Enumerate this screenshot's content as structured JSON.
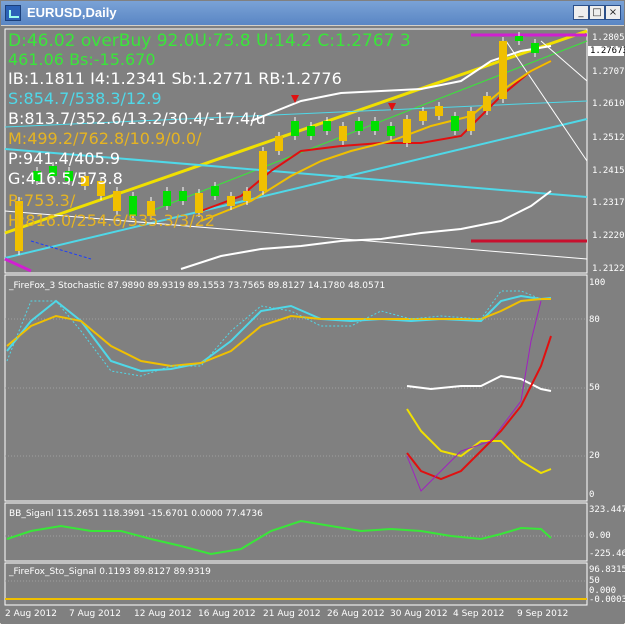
{
  "window": {
    "title": "EURUSD,Daily",
    "minimize": "_",
    "maximize": "□",
    "close": "×"
  },
  "info_lines": [
    {
      "text": "D:46.02 overBuy  92.0U:73.8 U:14.2 C:1.2767 3",
      "color": "#39e639"
    },
    {
      "text": "461.06 Bs:-15.670",
      "color": "#39e639"
    },
    {
      "text": "IB:1.1811 I4:1.2341 Sb:1.2771 RB:1.2776",
      "color": "#ffffff"
    },
    {
      "text": "S:854.7/538.3/12.9",
      "color": "#4fd8e8"
    },
    {
      "text": "B:813.7/352.6/13.2/30.4/-17.4/u",
      "color": "#ffffff"
    },
    {
      "text": "M:499.2/762.8/10.9/0.0/",
      "color": "#e6b422"
    },
    {
      "text": "P:941.4/405.9",
      "color": "#ffffff"
    },
    {
      "text": "G:416.5/573.8",
      "color": "#ffffff"
    },
    {
      "text": "R:753.3/",
      "color": "#e6b422"
    },
    {
      "text": "H:816.0/254.6/535.3/3/22",
      "color": "#e6b422"
    }
  ],
  "price_scale": [
    "1.28050",
    "1.27075",
    "1.26100",
    "1.25125",
    "1.24150",
    "1.23175",
    "1.22200",
    "1.21225"
  ],
  "current_price": "1.27673",
  "stoch_panel": {
    "title": "_FireFox_3 Stochastic 87.9890 89.9319 89.1553 73.7565 89.8127 14.1780 48.0571",
    "scale": [
      "100",
      "80",
      "50",
      "20",
      "0"
    ]
  },
  "bb_panel": {
    "title": "BB_Siganl 115.2651 118.3991 -15.6701 0.0000 77.4736",
    "scale": [
      "323.447",
      "0.00",
      "-225.460"
    ]
  },
  "sto_signal_panel": {
    "title": "_FireFox_Sto_Signal 0.1193 89.8127 89.9319",
    "scale": [
      "96.8315",
      "50",
      "0.000",
      "-0.000357"
    ]
  },
  "dates": [
    "2 Aug 2012",
    "7 Aug 2012",
    "12 Aug 2012",
    "16 Aug 2012",
    "21 Aug 2012",
    "26 Aug 2012",
    "30 Aug 2012",
    "4 Sep 2012",
    "9 Sep 2012"
  ],
  "colors": {
    "background": "#808080",
    "bull": "#00e000",
    "bear": "#f0c000",
    "cyan": "#4fd8e8",
    "red": "#e01010",
    "yellow": "#f0e000",
    "white": "#ffffff",
    "magenta": "#d020d0",
    "green": "#39e639"
  }
}
